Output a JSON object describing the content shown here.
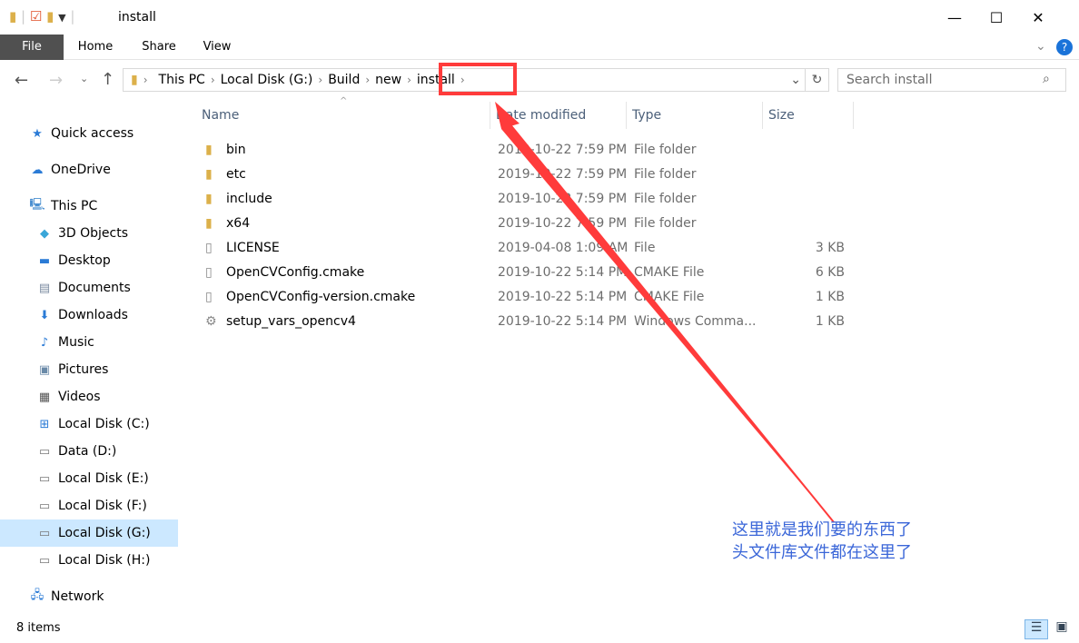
{
  "window": {
    "title": "install",
    "minimize": "—",
    "maximize": "☐",
    "close": "✕"
  },
  "ribbon": {
    "tabs": [
      "File",
      "Home",
      "Share",
      "View"
    ]
  },
  "address": {
    "crumbs": [
      "This PC",
      "Local Disk (G:)",
      "Build",
      "new",
      "install"
    ]
  },
  "search": {
    "placeholder": "Search install"
  },
  "sidebar": {
    "items": [
      {
        "label": "Quick access",
        "icon": "star-icon",
        "glyph": "★",
        "color": "#2b7bd6"
      },
      {
        "label": "OneDrive",
        "icon": "cloud-icon",
        "glyph": "☁",
        "color": "#2b7bd6"
      },
      {
        "label": "This PC",
        "icon": "computer-icon",
        "glyph": "🖳",
        "color": "#4a8fd0"
      },
      {
        "label": "3D Objects",
        "icon": "cube-icon",
        "glyph": "◆",
        "color": "#3aa6d8"
      },
      {
        "label": "Desktop",
        "icon": "desktop-icon",
        "glyph": "▬",
        "color": "#2b7bd6"
      },
      {
        "label": "Documents",
        "icon": "document-icon",
        "glyph": "▤",
        "color": "#7a8aa0"
      },
      {
        "label": "Downloads",
        "icon": "download-icon",
        "glyph": "⬇",
        "color": "#2b7bd6"
      },
      {
        "label": "Music",
        "icon": "music-icon",
        "glyph": "♪",
        "color": "#2b7bd6"
      },
      {
        "label": "Pictures",
        "icon": "pictures-icon",
        "glyph": "▣",
        "color": "#6a8aa8"
      },
      {
        "label": "Videos",
        "icon": "video-icon",
        "glyph": "▦",
        "color": "#555"
      },
      {
        "label": "Local Disk (C:)",
        "icon": "windows-drive-icon",
        "glyph": "⊞",
        "color": "#2b7bd6"
      },
      {
        "label": "Data (D:)",
        "icon": "drive-icon",
        "glyph": "▭",
        "color": "#777"
      },
      {
        "label": "Local Disk (E:)",
        "icon": "drive-icon",
        "glyph": "▭",
        "color": "#777"
      },
      {
        "label": "Local Disk (F:)",
        "icon": "drive-icon",
        "glyph": "▭",
        "color": "#777"
      },
      {
        "label": "Local Disk (G:)",
        "icon": "drive-icon",
        "glyph": "▭",
        "color": "#777",
        "selected": true
      },
      {
        "label": "Local Disk (H:)",
        "icon": "drive-icon",
        "glyph": "▭",
        "color": "#777"
      },
      {
        "label": "Network",
        "icon": "network-icon",
        "glyph": "🖧",
        "color": "#2b7bd6"
      }
    ]
  },
  "columns": [
    "Name",
    "Date modified",
    "Type",
    "Size"
  ],
  "files": [
    {
      "name": "bin",
      "date": "2019-10-22 7:59 PM",
      "type": "File folder",
      "size": "",
      "kind": "folder"
    },
    {
      "name": "etc",
      "date": "2019-10-22 7:59 PM",
      "type": "File folder",
      "size": "",
      "kind": "folder"
    },
    {
      "name": "include",
      "date": "2019-10-22 7:59 PM",
      "type": "File folder",
      "size": "",
      "kind": "folder"
    },
    {
      "name": "x64",
      "date": "2019-10-22 7:59 PM",
      "type": "File folder",
      "size": "",
      "kind": "folder"
    },
    {
      "name": "LICENSE",
      "date": "2019-04-08 1:09 AM",
      "type": "File",
      "size": "3 KB",
      "kind": "file"
    },
    {
      "name": "OpenCVConfig.cmake",
      "date": "2019-10-22 5:14 PM",
      "type": "CMAKE File",
      "size": "6 KB",
      "kind": "file"
    },
    {
      "name": "OpenCVConfig-version.cmake",
      "date": "2019-10-22 5:14 PM",
      "type": "CMAKE File",
      "size": "1 KB",
      "kind": "file"
    },
    {
      "name": "setup_vars_opencv4",
      "date": "2019-10-22 5:14 PM",
      "type": "Windows Comma...",
      "size": "1 KB",
      "kind": "script"
    }
  ],
  "status": {
    "count": "8 items"
  },
  "annotation": {
    "line1": "这里就是我们要的东西了",
    "line2": "头文件库文件都在这里了",
    "color": "#ff3b3b"
  }
}
